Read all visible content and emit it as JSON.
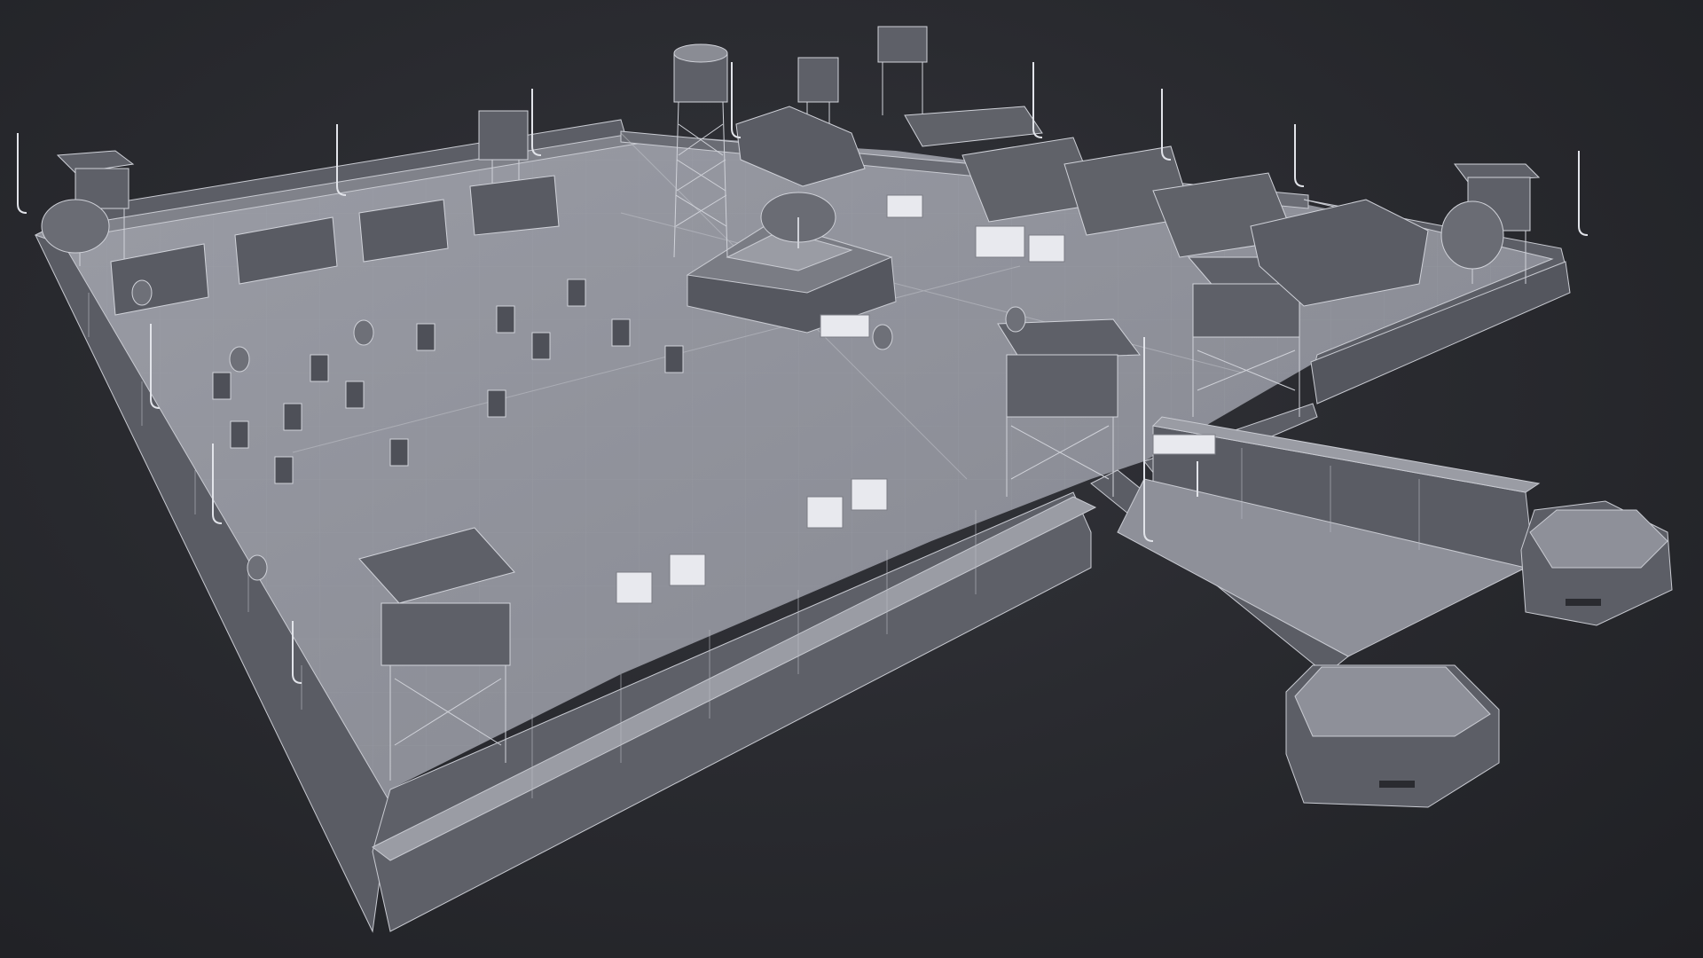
{
  "scene": {
    "kind": "low-poly military base 3D model render, wireframe overlay, orthographic-like perspective",
    "colors": {
      "background": "#2a2b30",
      "ground": "#8e9099",
      "wall_side": "#5c5e66",
      "wall_top": "#8f9199",
      "structure_dark": "#4e5058",
      "structure_mid": "#6c6e76",
      "wire": "#d9dbe2",
      "crate_light": "#e8e9ee"
    },
    "objects": {
      "watchtowers": 5,
      "water_towers": 3,
      "radar_dishes": 3,
      "hangars": 4,
      "tents": 3,
      "pillboxes": 2,
      "shooting_targets": 20,
      "lamp_posts": 16
    }
  }
}
